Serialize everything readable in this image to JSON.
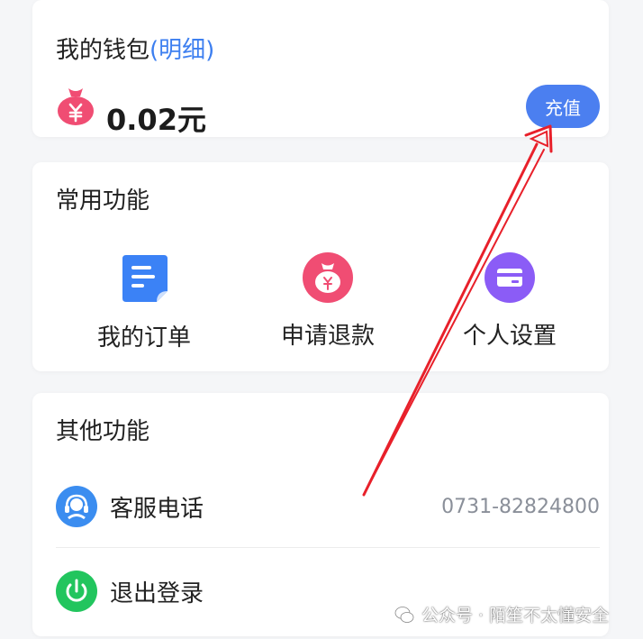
{
  "wallet": {
    "title": "我的钱包",
    "detail_link": "(明细)",
    "balance": "0.02元",
    "recharge_label": "充值"
  },
  "common_functions": {
    "title": "常用功能",
    "items": [
      {
        "label": "我的订单",
        "icon": "document-icon"
      },
      {
        "label": "申请退款",
        "icon": "money-bag-icon"
      },
      {
        "label": "个人设置",
        "icon": "card-icon"
      }
    ]
  },
  "other_functions": {
    "title": "其他功能",
    "items": [
      {
        "label": "客服电话",
        "value": "0731-82824800",
        "icon": "headset-icon"
      },
      {
        "label": "退出登录",
        "icon": "power-icon"
      }
    ]
  },
  "watermark": "公众号 · 陌笙不太懂安全",
  "colors": {
    "accent": "#4b7ff0",
    "link": "#3d7ff0",
    "money_bag": "#f04d73",
    "orders_icon": "#3b82f6",
    "settings_icon": "#8b5cf6",
    "service_icon": "#3b8df0",
    "logout_icon": "#22c55e",
    "annotation_arrow": "#e8202a"
  }
}
